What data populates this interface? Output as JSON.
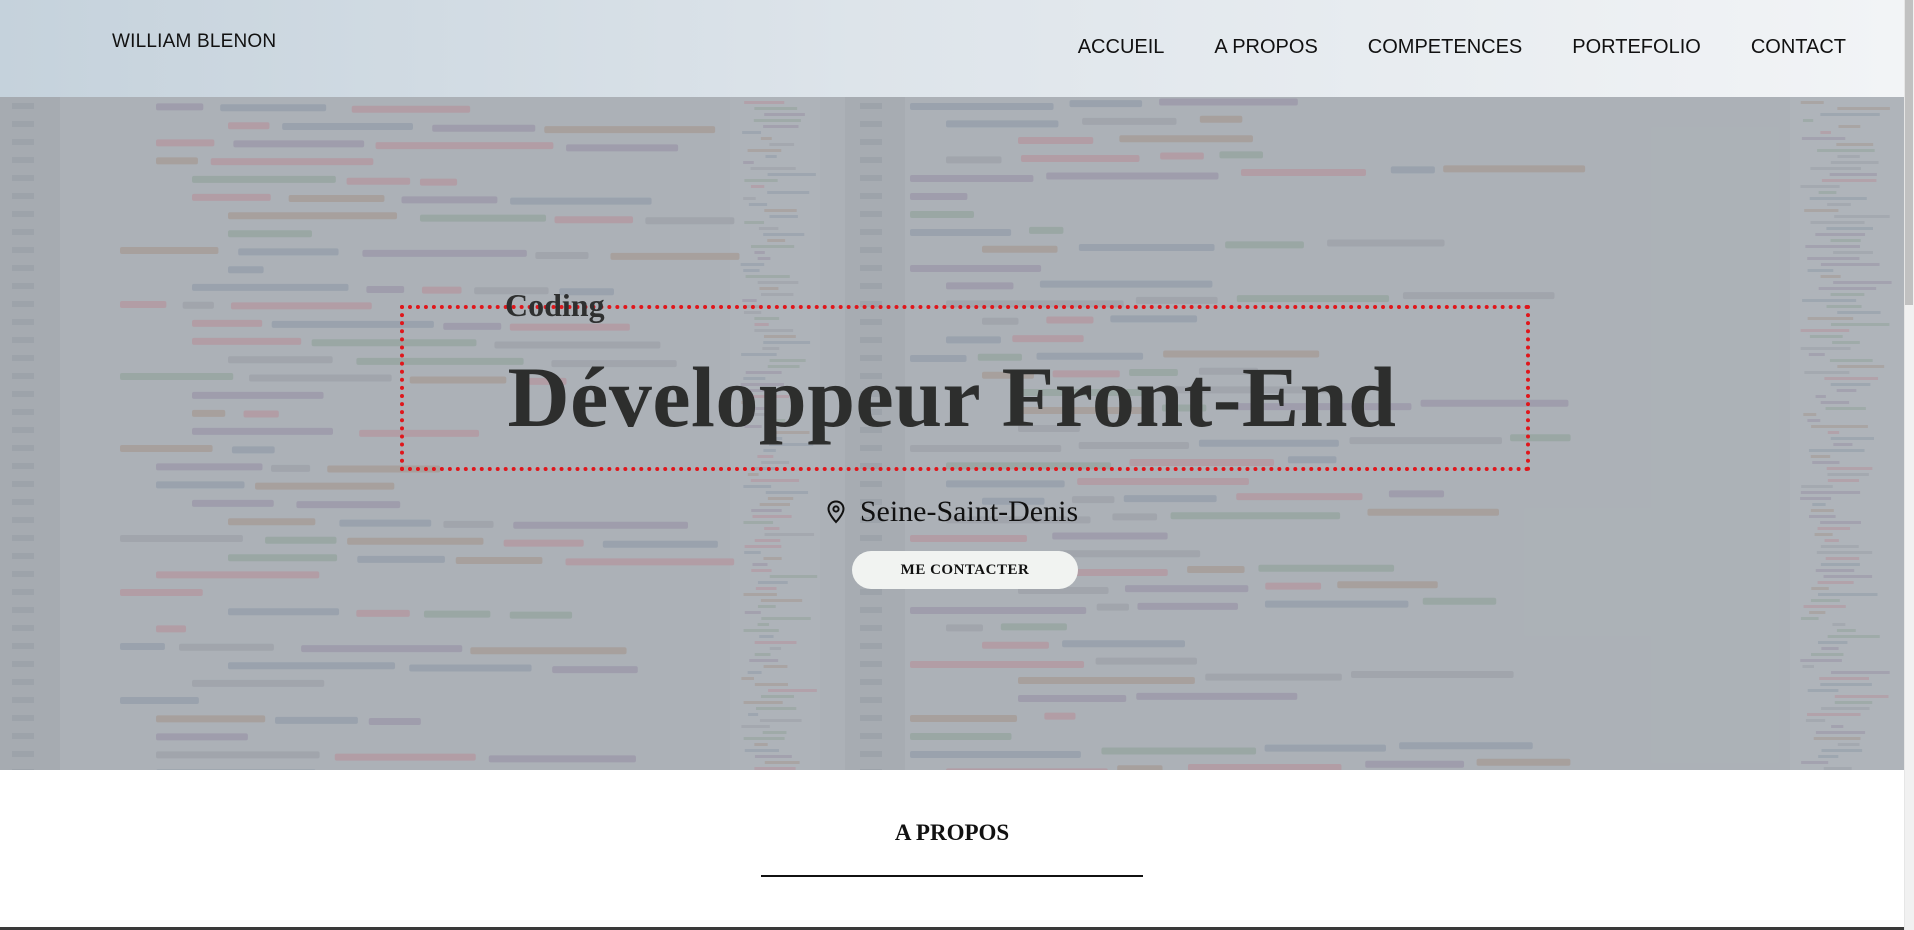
{
  "header": {
    "brand": "WILLIAM BLENON",
    "nav": [
      "ACCUEIL",
      "A PROPOS",
      "COMPETENCES",
      "PORTEFOLIO",
      "CONTACT"
    ]
  },
  "hero": {
    "kicker": "Coding",
    "headline": "Développeur Front-End",
    "location": "Seine-Saint-Denis",
    "cta_label": "ME CONTACTER"
  },
  "about": {
    "title": "A PROPOS"
  },
  "colors": {
    "focus_outline": "#e0161b",
    "headline_text": "#2d2e2d",
    "cta_background": "#f1f3f1"
  },
  "icons": {
    "location": "map-pin-icon"
  }
}
